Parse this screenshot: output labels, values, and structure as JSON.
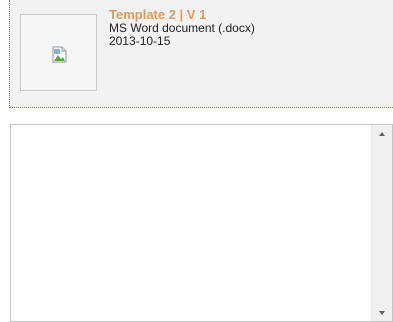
{
  "template": {
    "title": "Template 2 | V 1",
    "file_type": "MS Word document (.docx)",
    "date": "2013-10-15",
    "thumbnail_icon": "broken-image-icon"
  },
  "colors": {
    "title": "#e39a55",
    "card_background": "#f2f2f2",
    "card_border": "#5e9a3e"
  },
  "editor": {
    "value": "",
    "scroll_up_icon": "scroll-up-arrow-icon",
    "scroll_down_icon": "scroll-down-arrow-icon"
  }
}
